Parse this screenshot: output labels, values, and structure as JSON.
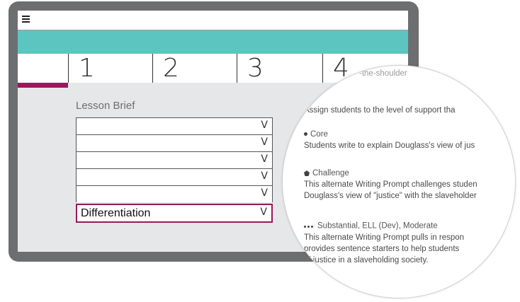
{
  "steps": [
    {
      "label": "1"
    },
    {
      "label": "2"
    },
    {
      "label": "3"
    },
    {
      "label": "4"
    }
  ],
  "lesson_brief": {
    "title": "Lesson Brief",
    "sections": [
      {
        "label": "",
        "chevron": "V"
      },
      {
        "label": "",
        "chevron": "V"
      },
      {
        "label": "",
        "chevron": "V"
      },
      {
        "label": "",
        "chevron": "V"
      },
      {
        "label": "",
        "chevron": "V"
      },
      {
        "label": "Differentiation",
        "chevron": "V"
      }
    ]
  },
  "magnifier": {
    "top_fragment": "-the-shoulder",
    "intro": "Assign students to the level of support tha",
    "core": {
      "heading": "Core",
      "text": "Students write to explain Douglass's view of jus"
    },
    "challenge": {
      "heading": "Challenge",
      "lines": [
        "This alternate Writing Prompt challenges studen",
        "Douglass's view of \"justice\" with the slaveholder"
      ]
    },
    "substantial": {
      "heading": "Substantial, ELL (Dev), Moderate",
      "lines": [
        "This alternate Writing Prompt pulls in respon",
        "provides sentence starters to help students",
        "of justice in a slaveholding society."
      ]
    }
  }
}
